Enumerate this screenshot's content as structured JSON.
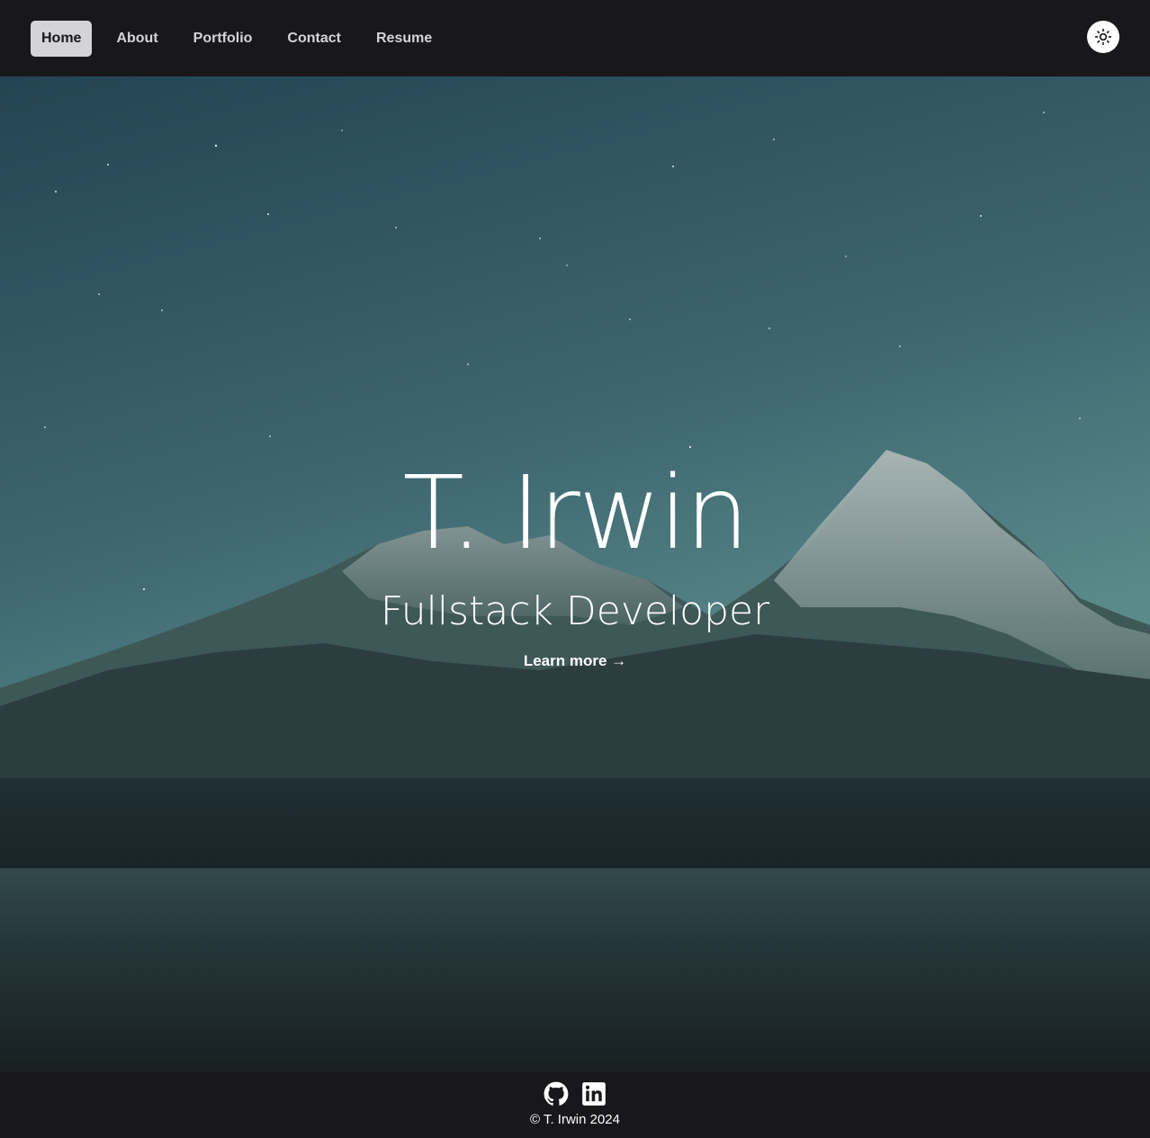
{
  "nav": {
    "items": [
      {
        "label": "Home",
        "active": true
      },
      {
        "label": "About",
        "active": false
      },
      {
        "label": "Portfolio",
        "active": false
      },
      {
        "label": "Contact",
        "active": false
      },
      {
        "label": "Resume",
        "active": false
      }
    ],
    "theme_toggle_icon": "sun-icon"
  },
  "hero": {
    "name": "T. Irwin",
    "title": "Fullstack Developer",
    "cta": "Learn more →"
  },
  "footer": {
    "icons": [
      "github-icon",
      "linkedin-icon"
    ],
    "copyright": "© T. Irwin 2024"
  },
  "colors": {
    "nav_bg": "#18181b",
    "active_pill": "#d4d4d8",
    "sky_top": "#234652",
    "sky_bottom": "#5a8a8a"
  }
}
